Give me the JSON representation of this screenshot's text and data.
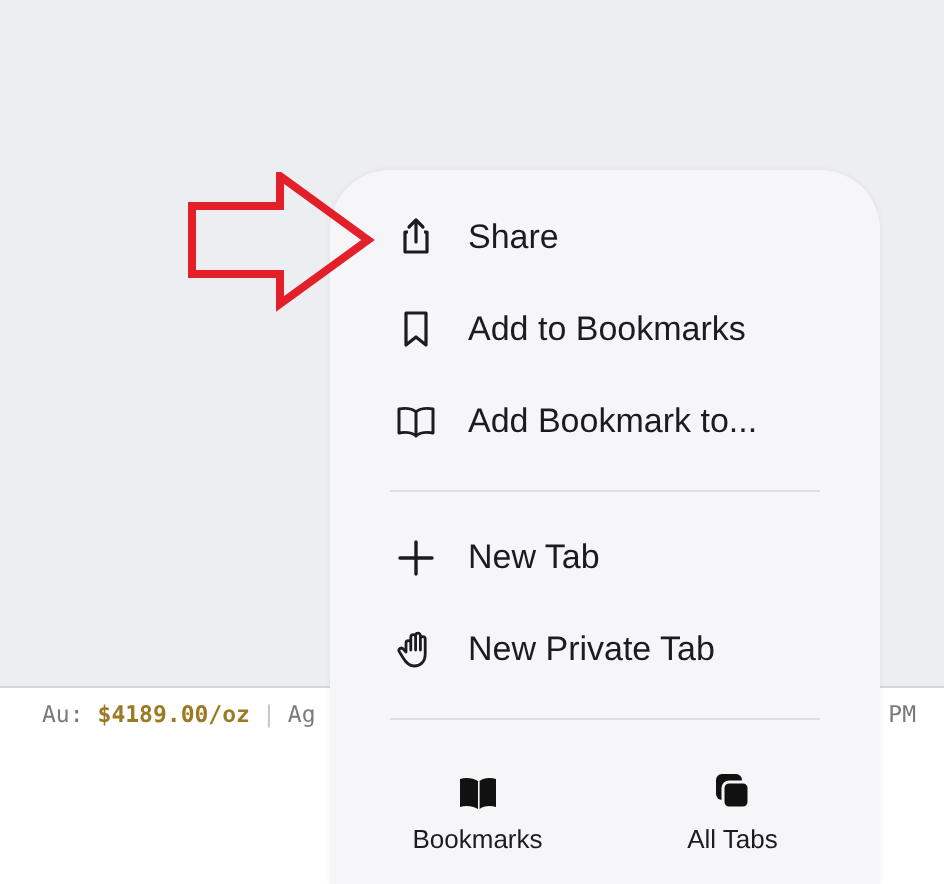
{
  "ticker": {
    "gold_label": "Au:",
    "gold_price": "$4189.00/oz",
    "separator": "|",
    "silver_label": "Ag",
    "right_text": "PM"
  },
  "menu": {
    "sections": [
      {
        "items": [
          {
            "label": "Share"
          },
          {
            "label": "Add to Bookmarks"
          },
          {
            "label": "Add Bookmark to..."
          }
        ]
      },
      {
        "items": [
          {
            "label": "New Tab"
          },
          {
            "label": "New Private Tab"
          }
        ]
      }
    ],
    "bottom_buttons": [
      {
        "label": "Bookmarks"
      },
      {
        "label": "All Tabs"
      }
    ]
  }
}
